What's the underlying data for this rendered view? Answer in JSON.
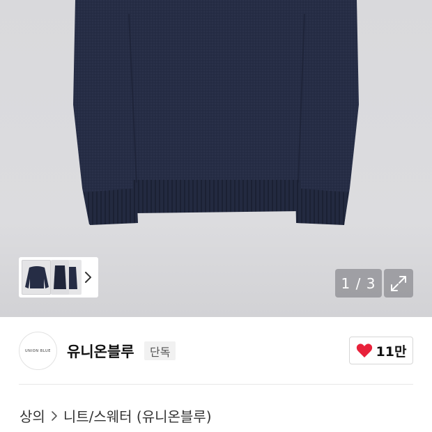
{
  "gallery": {
    "counter_text": "1 / 3",
    "current_index": 1,
    "total_images": 3,
    "thumbnail_next_icon": "chevron-right-icon",
    "expand_icon": "expand-arrows-icon"
  },
  "brand": {
    "logo_text": "UNION BLUE",
    "name": "유니온블루",
    "badge": "단독",
    "like_count": "11만",
    "like_icon": "heart-icon",
    "like_color": "#e8213a"
  },
  "breadcrumb": {
    "items": [
      "상의",
      "니트/스웨터 (유니온블루)"
    ],
    "separator_icon": "chevron-right-icon"
  },
  "colors": {
    "sweater": "#262d45",
    "background": "#dadadd"
  }
}
